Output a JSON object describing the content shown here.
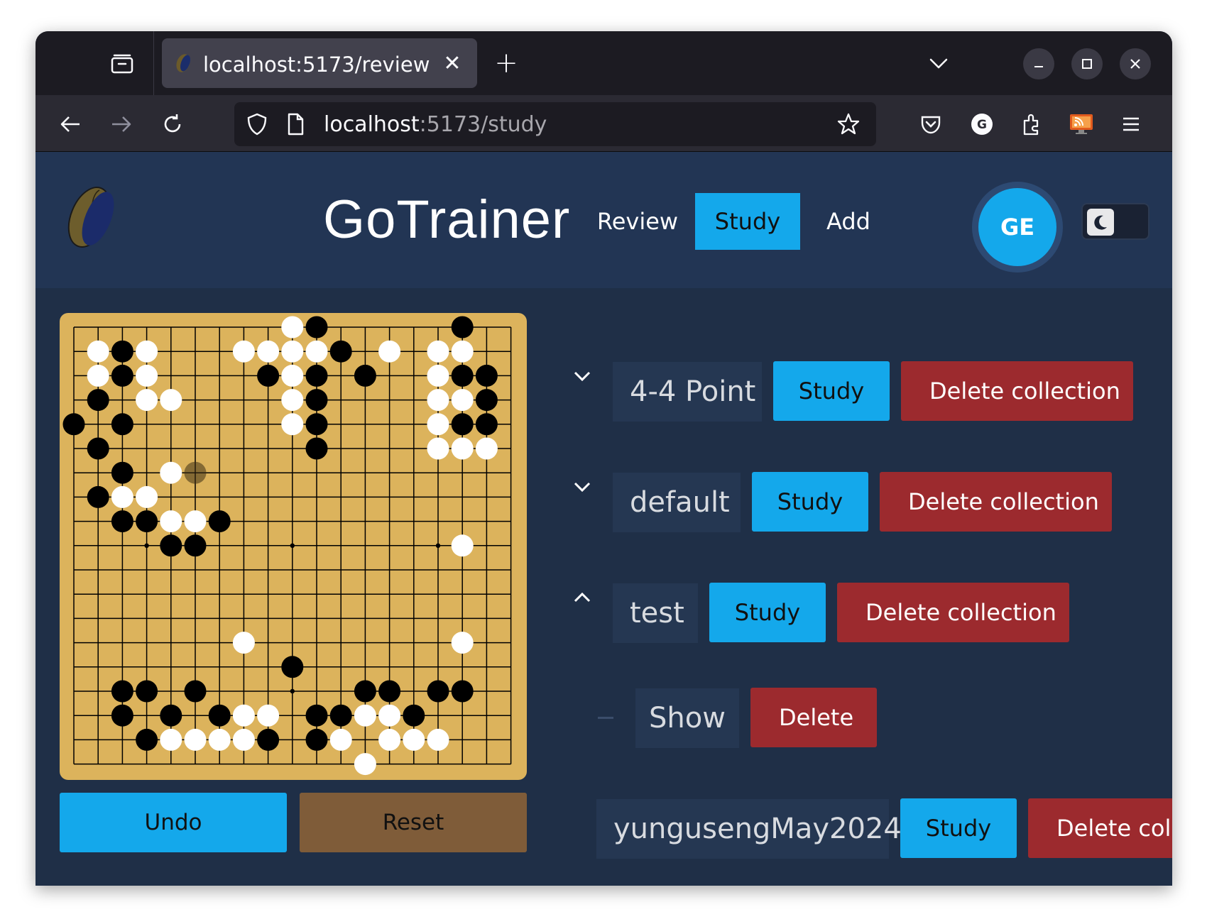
{
  "browser": {
    "tab_title": "localhost:5173/review",
    "url_host": "localhost",
    "url_path": ":5173/study"
  },
  "app": {
    "brand": "GoTrainer",
    "nav": [
      {
        "label": "Review",
        "active": false
      },
      {
        "label": "Study",
        "active": true
      },
      {
        "label": "Add",
        "active": false
      }
    ],
    "avatar_initials": "GE",
    "theme": "dark"
  },
  "board": {
    "size": 19,
    "black": [
      [
        10,
        0
      ],
      [
        16,
        0
      ],
      [
        2,
        1
      ],
      [
        11,
        1
      ],
      [
        2,
        2
      ],
      [
        8,
        2
      ],
      [
        10,
        2
      ],
      [
        12,
        2
      ],
      [
        16,
        2
      ],
      [
        17,
        2
      ],
      [
        1,
        3
      ],
      [
        10,
        3
      ],
      [
        17,
        3
      ],
      [
        0,
        4
      ],
      [
        2,
        4
      ],
      [
        10,
        4
      ],
      [
        16,
        4
      ],
      [
        17,
        4
      ],
      [
        1,
        5
      ],
      [
        10,
        5
      ],
      [
        2,
        6
      ],
      [
        1,
        7
      ],
      [
        2,
        8
      ],
      [
        3,
        8
      ],
      [
        6,
        8
      ],
      [
        4,
        9
      ],
      [
        5,
        9
      ],
      [
        9,
        14
      ],
      [
        2,
        15
      ],
      [
        3,
        15
      ],
      [
        5,
        15
      ],
      [
        12,
        15
      ],
      [
        13,
        15
      ],
      [
        15,
        15
      ],
      [
        16,
        15
      ],
      [
        2,
        16
      ],
      [
        4,
        16
      ],
      [
        6,
        16
      ],
      [
        10,
        16
      ],
      [
        11,
        16
      ],
      [
        14,
        16
      ],
      [
        3,
        17
      ],
      [
        8,
        17
      ],
      [
        10,
        17
      ]
    ],
    "white": [
      [
        9,
        0
      ],
      [
        1,
        1
      ],
      [
        3,
        1
      ],
      [
        7,
        1
      ],
      [
        8,
        1
      ],
      [
        9,
        1
      ],
      [
        10,
        1
      ],
      [
        13,
        1
      ],
      [
        15,
        1
      ],
      [
        16,
        1
      ],
      [
        1,
        2
      ],
      [
        3,
        2
      ],
      [
        9,
        2
      ],
      [
        15,
        2
      ],
      [
        3,
        3
      ],
      [
        4,
        3
      ],
      [
        9,
        3
      ],
      [
        15,
        3
      ],
      [
        16,
        3
      ],
      [
        9,
        4
      ],
      [
        15,
        4
      ],
      [
        15,
        5
      ],
      [
        16,
        5
      ],
      [
        17,
        5
      ],
      [
        4,
        6
      ],
      [
        2,
        7
      ],
      [
        3,
        7
      ],
      [
        4,
        8
      ],
      [
        5,
        8
      ],
      [
        16,
        9
      ],
      [
        7,
        13
      ],
      [
        16,
        13
      ],
      [
        7,
        16
      ],
      [
        8,
        16
      ],
      [
        12,
        16
      ],
      [
        13,
        16
      ],
      [
        4,
        17
      ],
      [
        5,
        17
      ],
      [
        6,
        17
      ],
      [
        7,
        17
      ],
      [
        11,
        17
      ],
      [
        13,
        17
      ],
      [
        14,
        17
      ],
      [
        15,
        17
      ],
      [
        12,
        18
      ]
    ],
    "ghost_black": [
      [
        5,
        6
      ]
    ],
    "hoshi": [
      [
        3,
        3
      ],
      [
        9,
        3
      ],
      [
        15,
        3
      ],
      [
        3,
        9
      ],
      [
        9,
        9
      ],
      [
        15,
        9
      ],
      [
        3,
        15
      ],
      [
        9,
        15
      ],
      [
        15,
        15
      ]
    ]
  },
  "controls": {
    "undo": "Undo",
    "reset": "Reset"
  },
  "collections": [
    {
      "name": "4-4 Point",
      "expanded": false,
      "study": "Study",
      "delete": "Delete collection"
    },
    {
      "name": "default",
      "expanded": false,
      "study": "Study",
      "delete": "Delete collection"
    },
    {
      "name": "test",
      "expanded": true,
      "study": "Study",
      "delete": "Delete collection",
      "items": [
        {
          "show": "Show",
          "delete": "Delete"
        }
      ]
    },
    {
      "name": "yungusengMay2024",
      "study": "Study",
      "delete": "Delete colle"
    }
  ]
}
